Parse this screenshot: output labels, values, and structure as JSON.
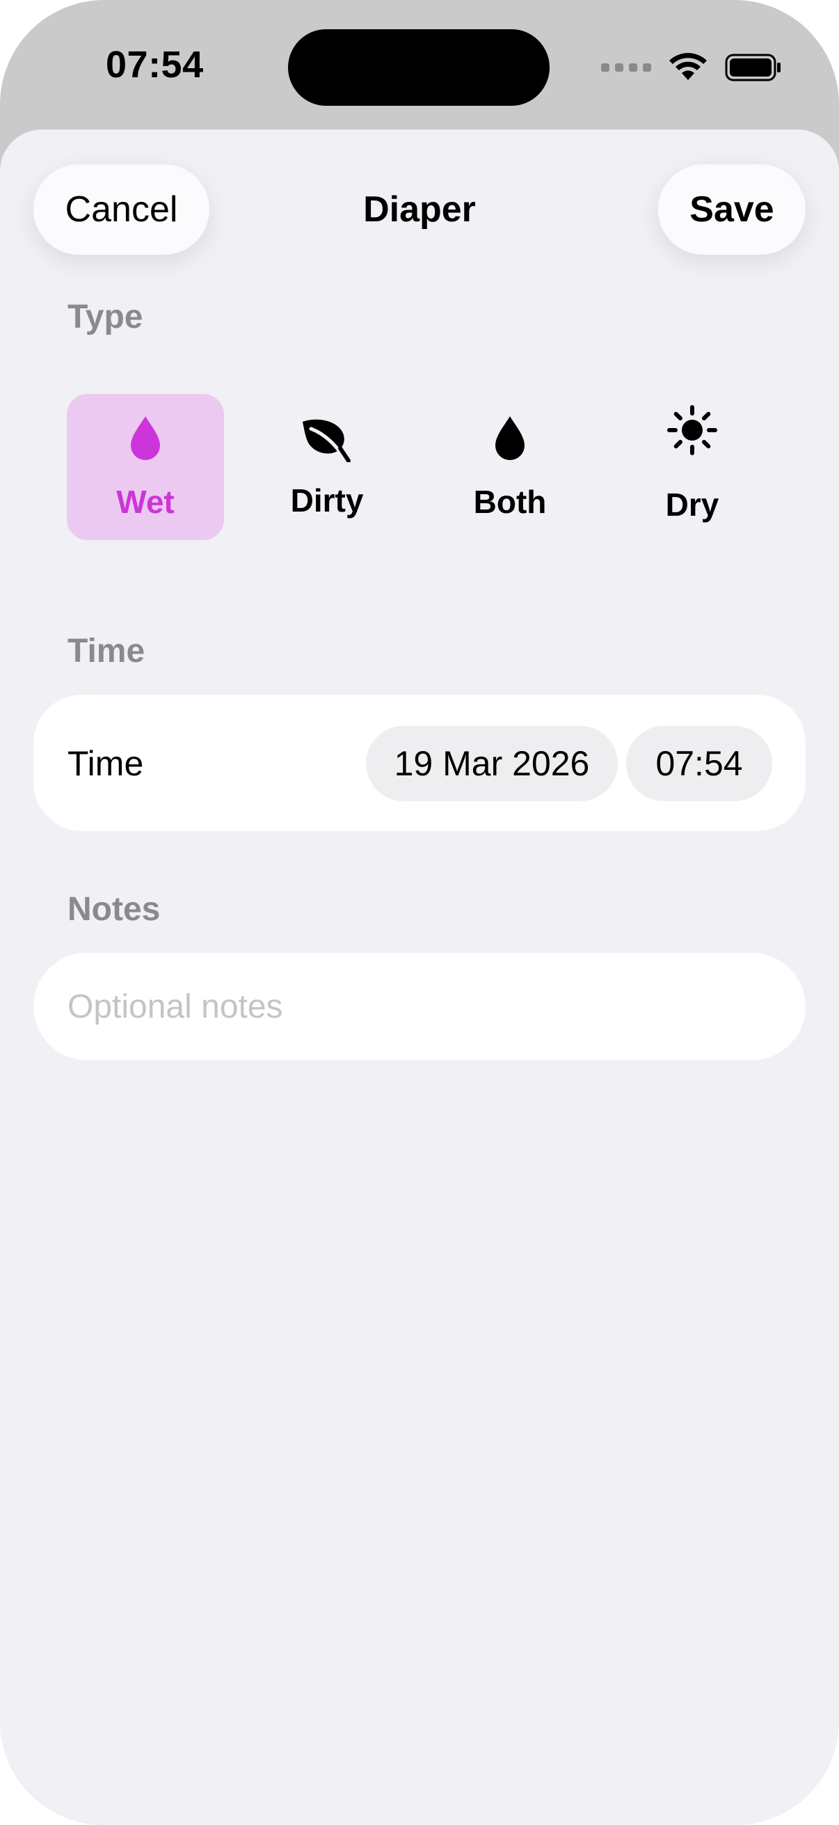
{
  "status_bar": {
    "time": "07:54"
  },
  "nav": {
    "cancel_label": "Cancel",
    "title": "Diaper",
    "save_label": "Save"
  },
  "sections": {
    "type": "Type",
    "time": "Time",
    "notes": "Notes"
  },
  "type_options": [
    {
      "label": "Wet",
      "icon": "drop-icon",
      "selected": true
    },
    {
      "label": "Dirty",
      "icon": "leaf-icon",
      "selected": false
    },
    {
      "label": "Both",
      "icon": "drop-icon",
      "selected": false
    },
    {
      "label": "Dry",
      "icon": "sun-icon",
      "selected": false
    }
  ],
  "time_row": {
    "label": "Time",
    "date": "19 Mar 2026",
    "time": "07:54"
  },
  "notes": {
    "placeholder": "Optional notes",
    "value": ""
  },
  "colors": {
    "accent": "#cc35da",
    "selected_bg": "#ecc9f1",
    "sheet_bg": "#f1f0f5"
  }
}
